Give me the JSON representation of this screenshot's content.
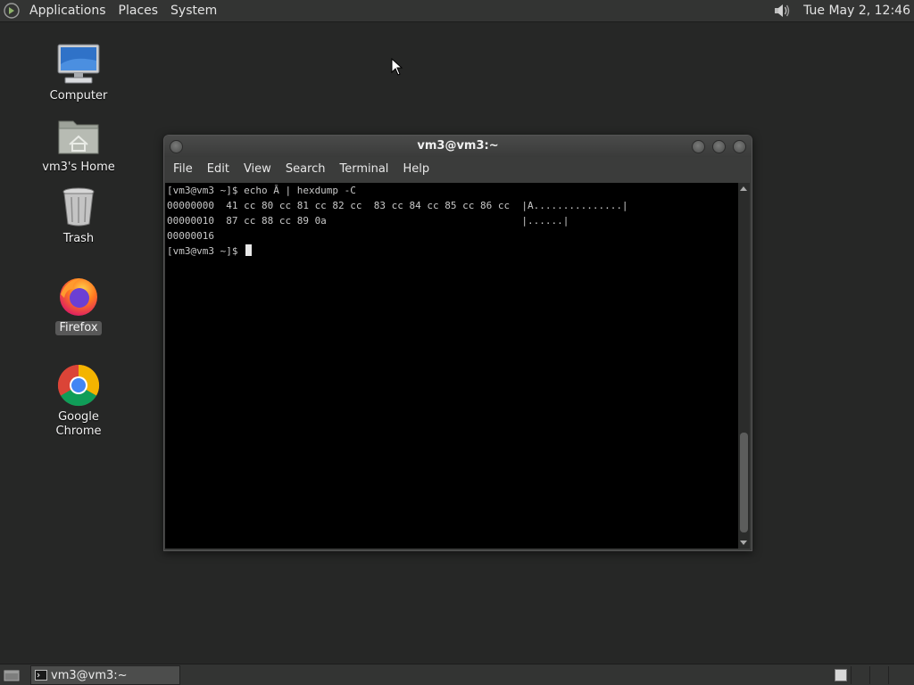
{
  "top_panel": {
    "menus": [
      "Applications",
      "Places",
      "System"
    ],
    "clock": "Tue May  2, 12:46",
    "icons": {
      "logo": "gnome-foot-icon",
      "volume": "speaker-volume-icon"
    }
  },
  "desktop_icons": [
    {
      "label": "Computer",
      "icon": "computer-monitor-icon"
    },
    {
      "label": "vm3's Home",
      "icon": "home-folder-icon"
    },
    {
      "label": "Trash",
      "icon": "trash-can-icon"
    },
    {
      "label": "Firefox",
      "icon": "firefox-icon",
      "selected": true
    },
    {
      "label": "Google Chrome",
      "icon": "chrome-icon"
    }
  ],
  "terminal": {
    "title": "vm3@vm3:~",
    "menus": [
      "File",
      "Edit",
      "View",
      "Search",
      "Terminal",
      "Help"
    ],
    "lines": [
      "[vm3@vm3 ~]$ echo Ā | hexdump -C",
      "00000000  41 cc 80 cc 81 cc 82 cc  83 cc 84 cc 85 cc 86 cc  |A...............|",
      "00000010  87 cc 88 cc 89 0a                                 |......|",
      "00000016"
    ],
    "prompt": "[vm3@vm3 ~]$ "
  },
  "taskbar": {
    "window_button": "vm3@vm3:~"
  },
  "colors": {
    "desktop": "#262726",
    "panel": "#333433",
    "terminal_bg": "#000000",
    "terminal_fg": "#c8c8c8"
  }
}
